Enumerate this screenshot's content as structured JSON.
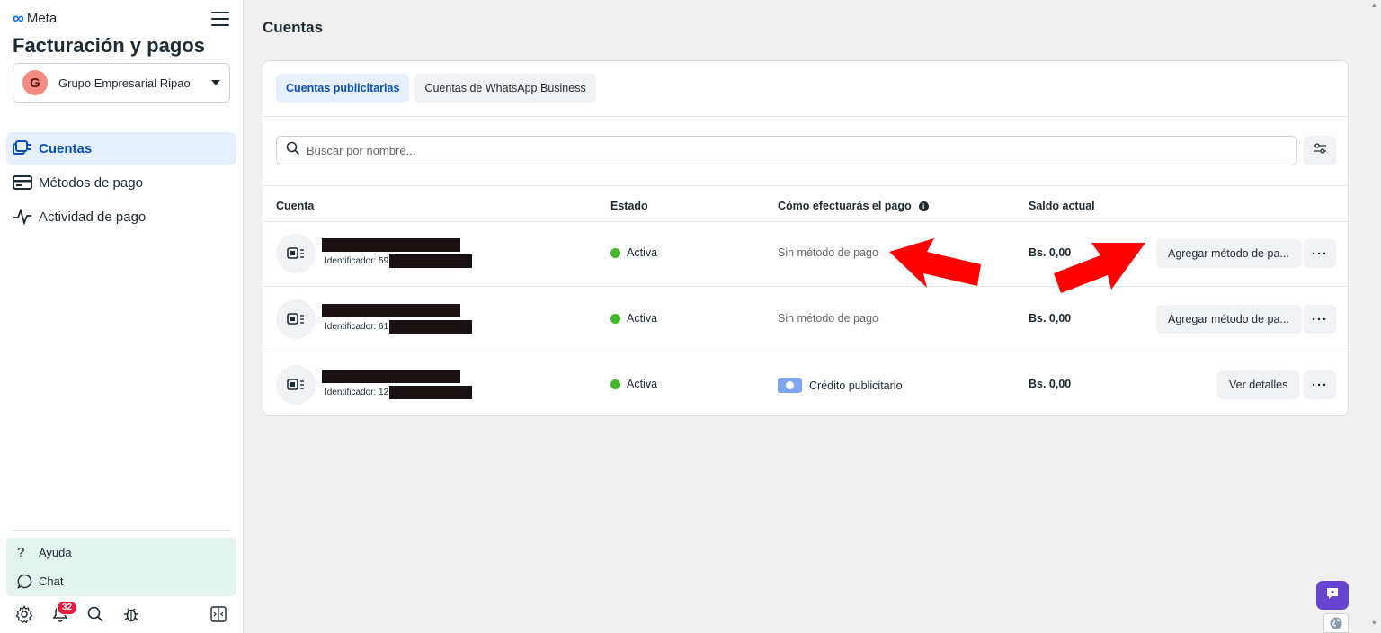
{
  "sidebar": {
    "brand": "Meta",
    "title": "Facturación y pagos",
    "business": {
      "initial": "G",
      "name": "Grupo Empresarial Ripao"
    },
    "nav": [
      {
        "label": "Cuentas",
        "icon": "accounts-icon",
        "active": true
      },
      {
        "label": "Métodos de pago",
        "icon": "credit-card-icon",
        "active": false
      },
      {
        "label": "Actividad de pago",
        "icon": "activity-pulse-icon",
        "active": false
      }
    ],
    "help": [
      {
        "label": "Ayuda",
        "icon": "question-icon"
      },
      {
        "label": "Chat",
        "icon": "chat-bubble-icon"
      }
    ],
    "bottom": {
      "notifications_count": "32"
    }
  },
  "main": {
    "title": "Cuentas",
    "tabs": [
      {
        "label": "Cuentas publicitarias",
        "active": true
      },
      {
        "label": "Cuentas de WhatsApp Business",
        "active": false
      }
    ],
    "search": {
      "placeholder": "Buscar por nombre..."
    },
    "columns": [
      "Cuenta",
      "Estado",
      "Cómo efectuarás el pago",
      "Saldo actual"
    ],
    "rows": [
      {
        "id_prefix": "Identificador: 59",
        "status": "Activa",
        "payment": "Sin método de pago",
        "balance": "Bs. 0,00",
        "action": "Agregar método de pa..."
      },
      {
        "id_prefix": "Identificador: 61",
        "status": "Activa",
        "payment": "Sin método de pago",
        "balance": "Bs. 0,00",
        "action": "Agregar método de pa..."
      },
      {
        "id_prefix": "Identificador: 12",
        "status": "Activa",
        "payment": "Crédito publicitario",
        "balance": "Bs. 0,00",
        "action": "Ver detalles"
      }
    ],
    "more_label": "···"
  },
  "colors": {
    "accent": "#0866ff",
    "active_bg": "#e7f0fe",
    "status_active": "#42b72a",
    "annotation_arrow": "#ff0000",
    "chat_fab": "#6744d0"
  }
}
